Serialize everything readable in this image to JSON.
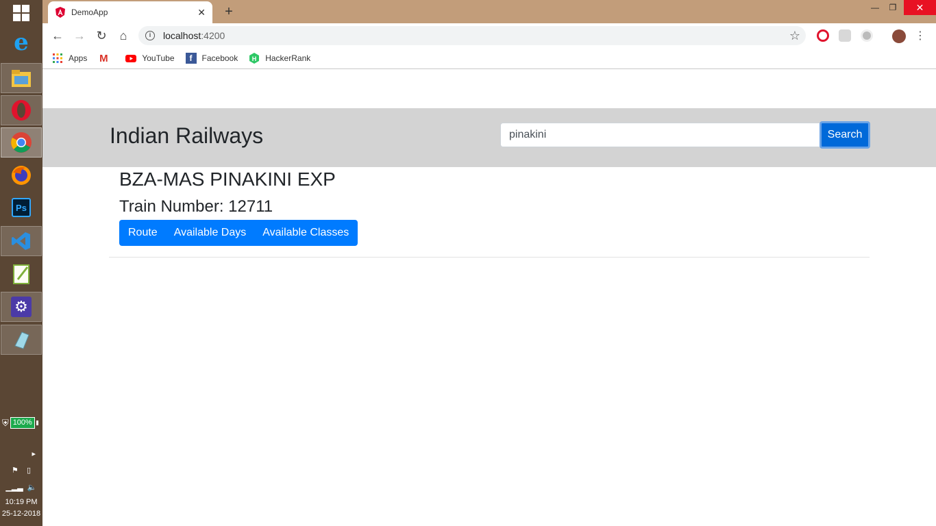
{
  "taskbar": {
    "apps": [
      {
        "name": "internet-explorer",
        "label": "e"
      },
      {
        "name": "file-explorer",
        "label": ""
      },
      {
        "name": "opera",
        "label": ""
      },
      {
        "name": "chrome",
        "label": ""
      },
      {
        "name": "firefox",
        "label": ""
      },
      {
        "name": "photoshop",
        "label": "Ps"
      },
      {
        "name": "vscode",
        "label": ""
      },
      {
        "name": "notepad-plus-plus",
        "label": ""
      },
      {
        "name": "settings",
        "label": ""
      },
      {
        "name": "eraser-app",
        "label": ""
      }
    ],
    "battery": "100%",
    "time": "10:19 PM",
    "date": "25-12-2018"
  },
  "browser": {
    "tab_title": "DemoApp",
    "url_host": "localhost",
    "url_port": ":4200",
    "bookmarks": [
      {
        "label": "Apps",
        "icon": "apps-grid-icon"
      },
      {
        "label": "",
        "icon": "gmail-icon"
      },
      {
        "label": "YouTube",
        "icon": "youtube-icon"
      },
      {
        "label": "Facebook",
        "icon": "facebook-icon"
      },
      {
        "label": "HackerRank",
        "icon": "hackerrank-icon"
      }
    ]
  },
  "app": {
    "brand": "Indian Railways",
    "search": {
      "value": "pinakini",
      "button": "Search"
    },
    "train": {
      "name": "BZA-MAS PINAKINI EXP",
      "number_text": "Train Number: 12711"
    },
    "actions": [
      "Route",
      "Available Days",
      "Available Classes"
    ]
  },
  "colors": {
    "taskbar": "#5a4634",
    "chrome_frame": "#c29d7a",
    "header_bg": "#d3d3d3",
    "primary": "#007bff"
  }
}
